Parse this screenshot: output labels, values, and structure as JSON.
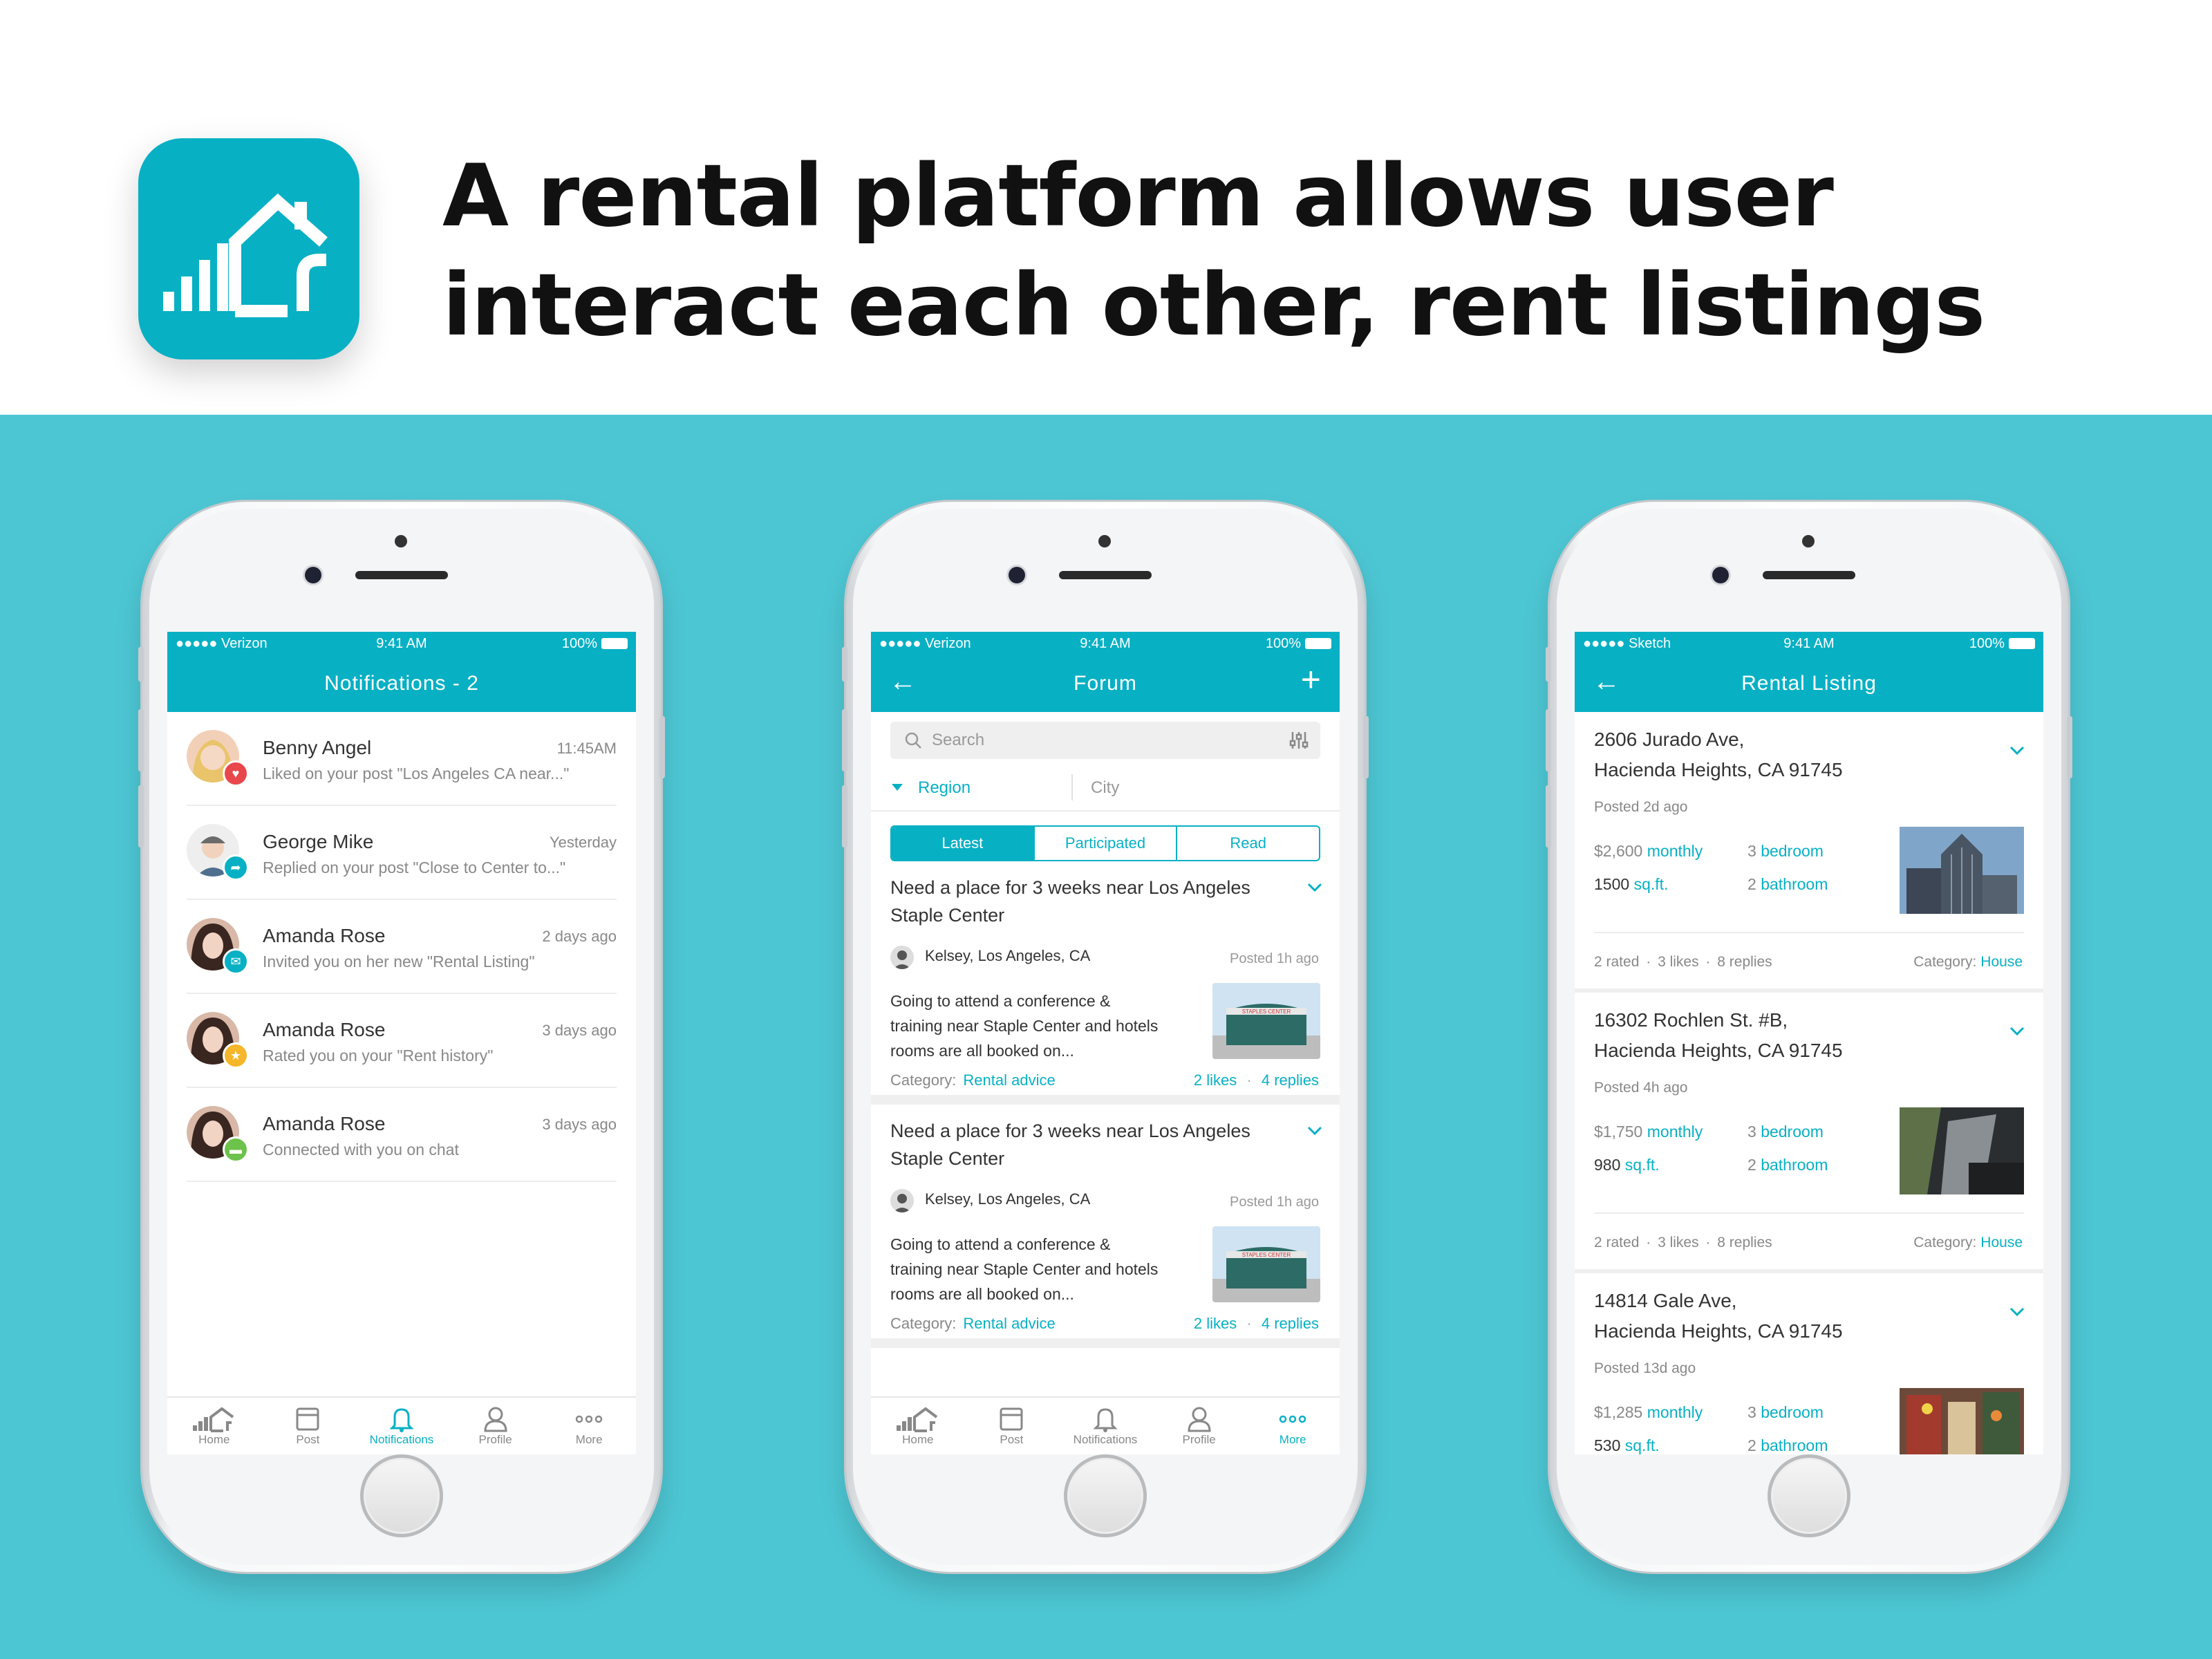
{
  "headline": {
    "line1": "A rental platform allows user",
    "line2": "interact each other, rent listings"
  },
  "colors": {
    "brand": "#08B0C4",
    "band": "#4DC6D3"
  },
  "tabbar": [
    {
      "label": "Home",
      "icon": "home-icon"
    },
    {
      "label": "Post",
      "icon": "post-icon"
    },
    {
      "label": "Notifications",
      "icon": "bell-icon"
    },
    {
      "label": "Profile",
      "icon": "profile-icon"
    },
    {
      "label": "More",
      "icon": "more-icon"
    }
  ],
  "phone1": {
    "status": {
      "carrier": "●●●●● Verizon",
      "time": "9:41 AM",
      "battery": "100%"
    },
    "title": "Notifications - 2",
    "active_tab": "Notifications",
    "items": [
      {
        "name": "Benny Angel",
        "when": "11:45AM",
        "message": "Liked on your post \"Los Angeles CA near...\"",
        "badge": "heart-icon",
        "badge_color": "#E8474C"
      },
      {
        "name": "George Mike",
        "when": "Yesterday",
        "message": "Replied on your post \"Close to Center to...\"",
        "badge": "reply-icon",
        "badge_color": "#08B0C4"
      },
      {
        "name": "Amanda Rose",
        "when": "2 days ago",
        "message": "Invited you on her new \"Rental Listing\"",
        "badge": "mail-icon",
        "badge_color": "#08B0C4"
      },
      {
        "name": "Amanda Rose",
        "when": "3 days ago",
        "message": "Rated you on your \"Rent history\"",
        "badge": "star-icon",
        "badge_color": "#F5B62A"
      },
      {
        "name": "Amanda Rose",
        "when": "3 days ago",
        "message": "Connected with you on chat",
        "badge": "chat-icon",
        "badge_color": "#6CC24A"
      }
    ]
  },
  "phone2": {
    "status": {
      "carrier": "●●●●● Verizon",
      "time": "9:41 AM",
      "battery": "100%"
    },
    "title": "Forum",
    "search_placeholder": "Search",
    "region": "Region",
    "city": "City",
    "segments": [
      "Latest",
      "Participated",
      "Read"
    ],
    "active_tab": "More",
    "posts": [
      {
        "title": "Need a place for 3 weeks near Los Angeles Staple Center",
        "author": "Kelsey, Los Angeles, CA",
        "posted": "Posted 1h ago",
        "body": "Going to attend a conference & training near Staple Center and hotels rooms are all booked on...",
        "category_label": "Category:",
        "category": "Rental advice",
        "likes": "2 likes",
        "replies": "4 replies"
      },
      {
        "title": "Need a place for 3 weeks near Los Angeles Staple Center",
        "author": "Kelsey, Los Angeles, CA",
        "posted": "Posted 1h ago",
        "body": "Going to attend a conference & training near Staple Center and hotels rooms are all booked on...",
        "category_label": "Category:",
        "category": "Rental advice",
        "likes": "2 likes",
        "replies": "4 replies"
      }
    ]
  },
  "phone3": {
    "status": {
      "carrier": "●●●●● Sketch",
      "time": "9:41 AM",
      "battery": "100%"
    },
    "title": "Rental Listing",
    "listings": [
      {
        "addr1": "2606 Jurado Ave,",
        "addr2": "Hacienda Heights, CA 91745",
        "posted": "Posted 2d ago",
        "price": "$2,600",
        "price_unit": "monthly",
        "sqft": "1500",
        "sqft_unit": "sq.ft.",
        "bed": "3",
        "bed_unit": "bedroom",
        "bath": "2",
        "bath_unit": "bathroom",
        "rated": "2 rated",
        "likes": "3 likes",
        "replies": "8 replies",
        "category_label": "Category:",
        "category": "House"
      },
      {
        "addr1": "16302 Rochlen St. #B,",
        "addr2": "Hacienda Heights, CA 91745",
        "posted": "Posted 4h ago",
        "price": "$1,750",
        "price_unit": "monthly",
        "sqft": "980",
        "sqft_unit": "sq.ft.",
        "bed": "3",
        "bed_unit": "bedroom",
        "bath": "2",
        "bath_unit": "bathroom",
        "rated": "2 rated",
        "likes": "3 likes",
        "replies": "8 replies",
        "category_label": "Category:",
        "category": "House"
      },
      {
        "addr1": "14814 Gale Ave,",
        "addr2": "Hacienda Heights, CA 91745",
        "posted": "Posted 13d ago",
        "price": "$1,285",
        "price_unit": "monthly",
        "sqft": "530",
        "sqft_unit": "sq.ft.",
        "bed": "3",
        "bed_unit": "bedroom",
        "bath": "2",
        "bath_unit": "bathroom"
      }
    ]
  }
}
